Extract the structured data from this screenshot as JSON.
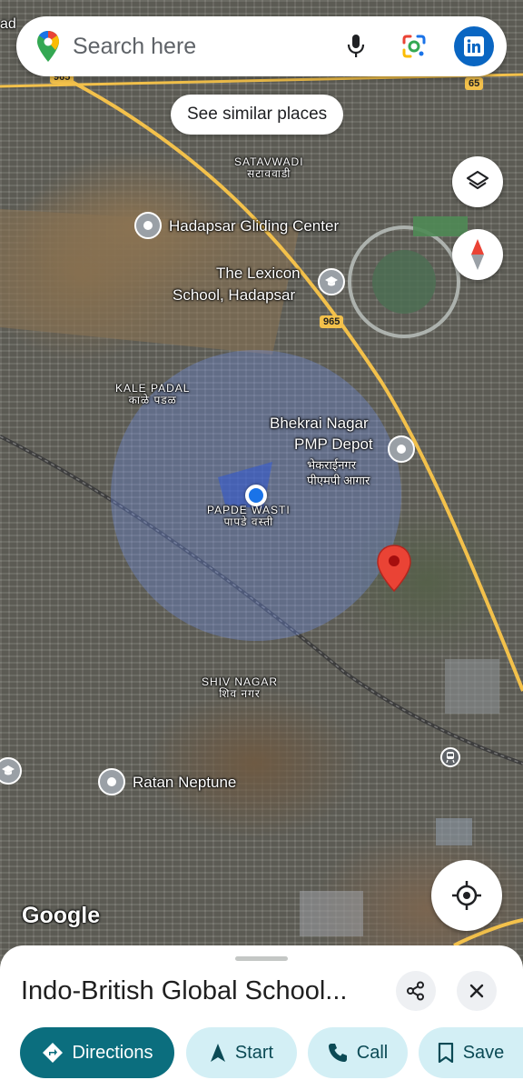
{
  "search": {
    "placeholder": "Search here"
  },
  "chip": {
    "label": "See similar places"
  },
  "map": {
    "labels": {
      "satavwadi": "SATAVWADI",
      "satavwadi_local": "सटाववाडी",
      "gliding": "Hadapsar Gliding Center",
      "lexicon_1": "The Lexicon",
      "lexicon_2": "School, Hadapsar",
      "kale_padal": "KALE PADAL",
      "kale_padal_local": "काळे पडळ",
      "bhekrai_1": "Bhekrai Nagar",
      "bhekrai_2": "PMP Depot",
      "bhekrai_local_1": "भेकराईनगर",
      "bhekrai_local_2": "पीएमपी आगार",
      "papde": "PAPDE WASTI",
      "papde_local": "पापडे वस्ती",
      "shiv_nagar": "SHIV NAGAR",
      "shiv_nagar_local": "शिव नगर",
      "ratan": "Ratan Neptune",
      "edge_text": "ad",
      "google": "Google"
    },
    "road_shields": {
      "r965a": "965",
      "r65": "65",
      "r965b": "965"
    },
    "colors": {
      "pin": "#ea4335",
      "location_dot": "#1a73e8",
      "road": "#f3c14b"
    }
  },
  "sheet": {
    "title": "Indo-British Global School...",
    "actions": {
      "directions": "Directions",
      "start": "Start",
      "call": "Call",
      "save": "Save"
    }
  },
  "icons": {
    "maps_logo": "google-maps-pin",
    "mic": "microphone",
    "lens": "google-lens",
    "account": "linkedin",
    "layers": "layers",
    "compass": "compass",
    "my_location": "crosshair",
    "share": "share",
    "close": "close"
  }
}
